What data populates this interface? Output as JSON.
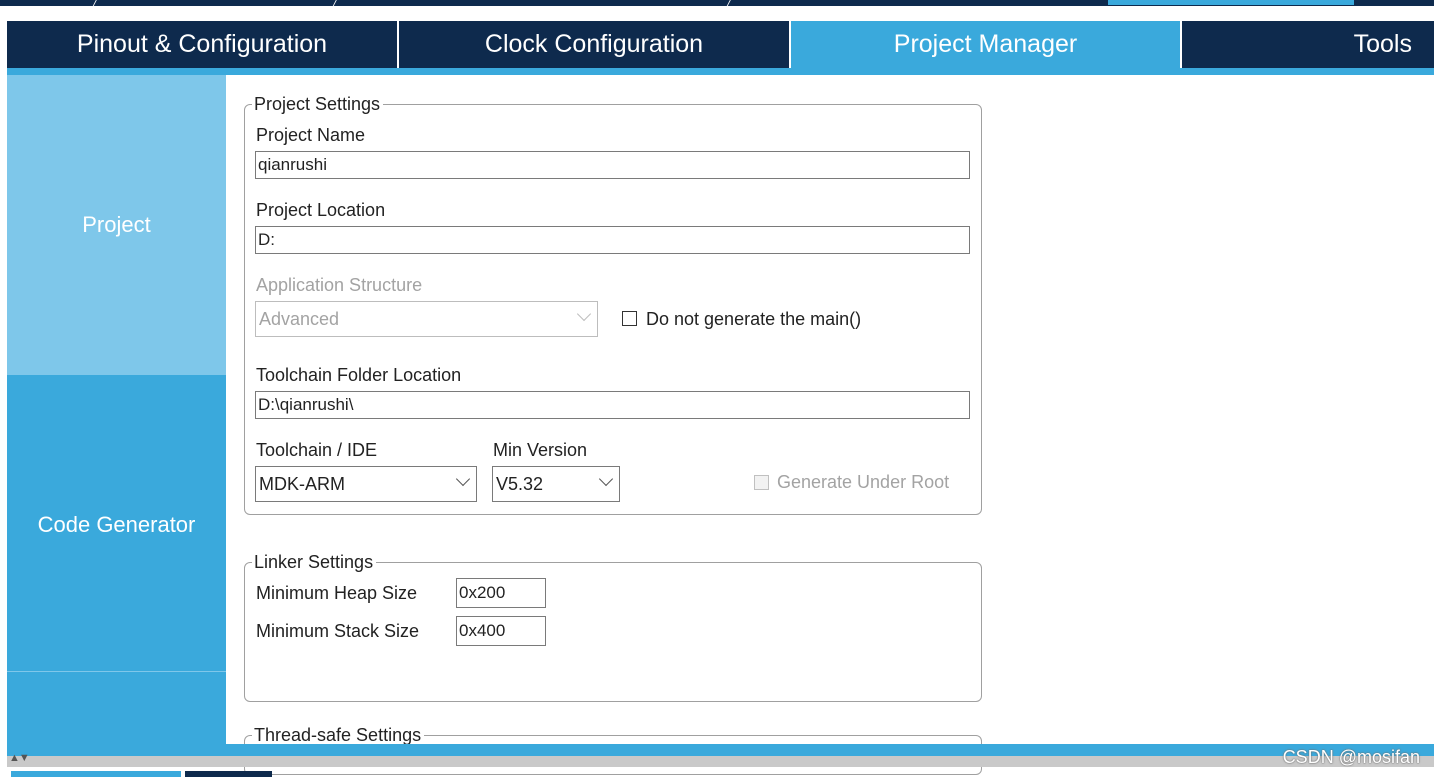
{
  "tabs": [
    "Pinout & Configuration",
    "Clock Configuration",
    "Project Manager",
    "Tools"
  ],
  "sidebar": {
    "items": [
      "Project",
      "Code Generator"
    ]
  },
  "project_settings": {
    "title": "Project Settings",
    "project_name_label": "Project Name",
    "project_name_value": "qianrushi",
    "project_location_label": "Project Location",
    "project_location_value": "D:",
    "app_structure_label": "Application Structure",
    "app_structure_value": "Advanced",
    "no_main_label": "Do not generate the main()",
    "toolchain_folder_label": "Toolchain Folder Location",
    "toolchain_folder_value": "D:\\qianrushi\\",
    "toolchain_ide_label": "Toolchain / IDE",
    "toolchain_ide_value": "MDK-ARM",
    "min_version_label": "Min Version",
    "min_version_value": "V5.32",
    "generate_under_root_label": "Generate Under Root"
  },
  "linker_settings": {
    "title": "Linker Settings",
    "heap_label": "Minimum Heap Size",
    "heap_value": "0x200",
    "stack_label": "Minimum Stack Size",
    "stack_value": "0x400"
  },
  "thread_safe": {
    "title": "Thread-safe Settings"
  },
  "watermark": "CSDN @mosifan",
  "colors": {
    "navy": "#0e2a4d",
    "accent": "#3aa9dc",
    "sidebar_active": "#7ec7ea"
  }
}
